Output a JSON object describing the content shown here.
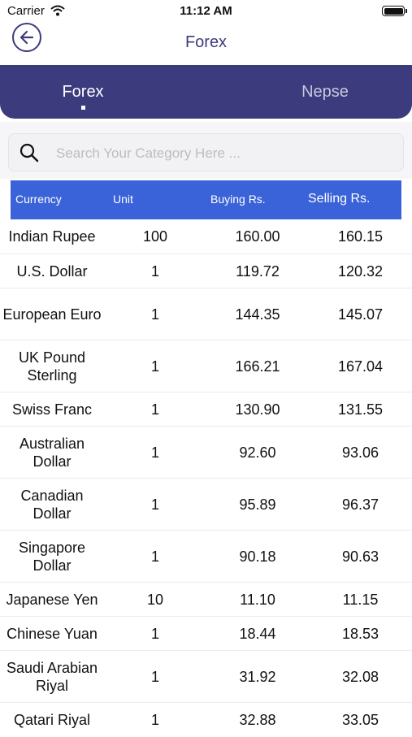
{
  "status_bar": {
    "carrier": "Carrier",
    "time": "11:12 AM"
  },
  "nav": {
    "title": "Forex"
  },
  "tabs": [
    {
      "label": "Forex",
      "active": true
    },
    {
      "label": "Nepse",
      "active": false
    }
  ],
  "search": {
    "placeholder": "Search Your Category Here ..."
  },
  "table": {
    "headers": {
      "currency": "Currency",
      "unit": "Unit",
      "buying": "Buying Rs.",
      "selling": "Selling Rs."
    },
    "rows": [
      {
        "currency": "Indian Rupee",
        "unit": "100",
        "buying": "160.00",
        "selling": "160.15"
      },
      {
        "currency": "U.S. Dollar",
        "unit": "1",
        "buying": "119.72",
        "selling": "120.32"
      },
      {
        "currency": "European Euro",
        "unit": "1",
        "buying": "144.35",
        "selling": "145.07"
      },
      {
        "currency": "UK Pound Sterling",
        "unit": "1",
        "buying": "166.21",
        "selling": "167.04"
      },
      {
        "currency": "Swiss Franc",
        "unit": "1",
        "buying": "130.90",
        "selling": "131.55"
      },
      {
        "currency": "Australian Dollar",
        "unit": "1",
        "buying": "92.60",
        "selling": "93.06"
      },
      {
        "currency": "Canadian Dollar",
        "unit": "1",
        "buying": "95.89",
        "selling": "96.37"
      },
      {
        "currency": "Singapore Dollar",
        "unit": "1",
        "buying": "90.18",
        "selling": "90.63"
      },
      {
        "currency": "Japanese Yen",
        "unit": "10",
        "buying": "11.10",
        "selling": "11.15"
      },
      {
        "currency": "Chinese Yuan",
        "unit": "1",
        "buying": "18.44",
        "selling": "18.53"
      },
      {
        "currency": "Saudi Arabian Riyal",
        "unit": "1",
        "buying": "31.92",
        "selling": "32.08"
      },
      {
        "currency": "Qatari Riyal",
        "unit": "1",
        "buying": "32.88",
        "selling": "33.05"
      }
    ]
  },
  "colors": {
    "primary": "#3c3b7e",
    "table_header": "#3b63d9"
  },
  "icons": {
    "back": "arrow-left-circle-icon",
    "search": "search-icon",
    "wifi": "wifi-icon",
    "battery": "battery-icon"
  }
}
